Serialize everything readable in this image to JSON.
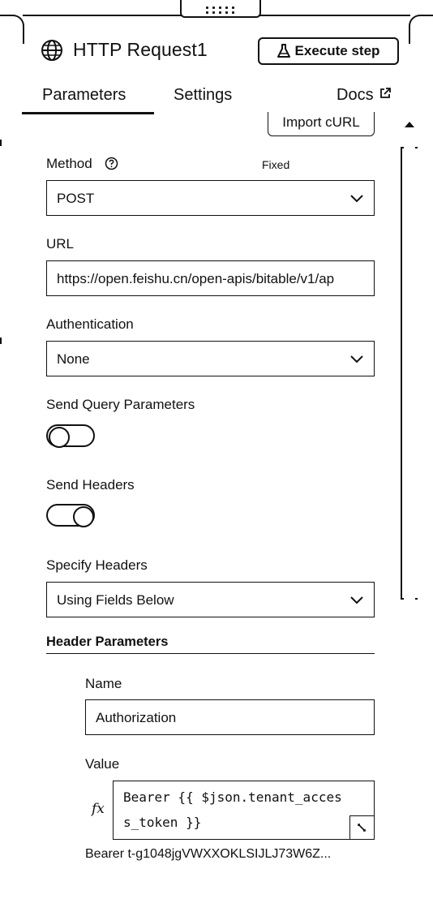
{
  "header": {
    "title": "HTTP Request1",
    "execute_label": "Execute step",
    "node_icon": "globe-icon",
    "execute_icon": "flask-icon"
  },
  "tabs": [
    {
      "label": "Parameters",
      "active": true
    },
    {
      "label": "Settings",
      "active": false
    },
    {
      "label": "Docs",
      "icon": "external-link-icon"
    }
  ],
  "import_curl_label": "Import cURL",
  "method": {
    "label": "Method",
    "badge": "Fixed",
    "value": "POST",
    "icon": "help-circle-icon"
  },
  "url": {
    "label": "URL",
    "value": "https://open.feishu.cn/open-apis/bitable/v1/ap"
  },
  "authentication": {
    "label": "Authentication",
    "value": "None"
  },
  "send_query": {
    "label": "Send Query Parameters",
    "enabled": false
  },
  "send_headers": {
    "label": "Send Headers",
    "enabled": true
  },
  "specify_headers": {
    "label": "Specify Headers",
    "value": "Using Fields Below"
  },
  "header_params": {
    "label": "Header Parameters",
    "name_label": "Name",
    "name_value": "Authorization",
    "value_label": "Value",
    "fx_label": "fx",
    "value_line1": "Bearer {{ $json.tenant_acces",
    "value_line2": "s_token }}",
    "preview": "Bearer t-g1048jgVWXXOKLSIJLJ73W6Z..."
  }
}
